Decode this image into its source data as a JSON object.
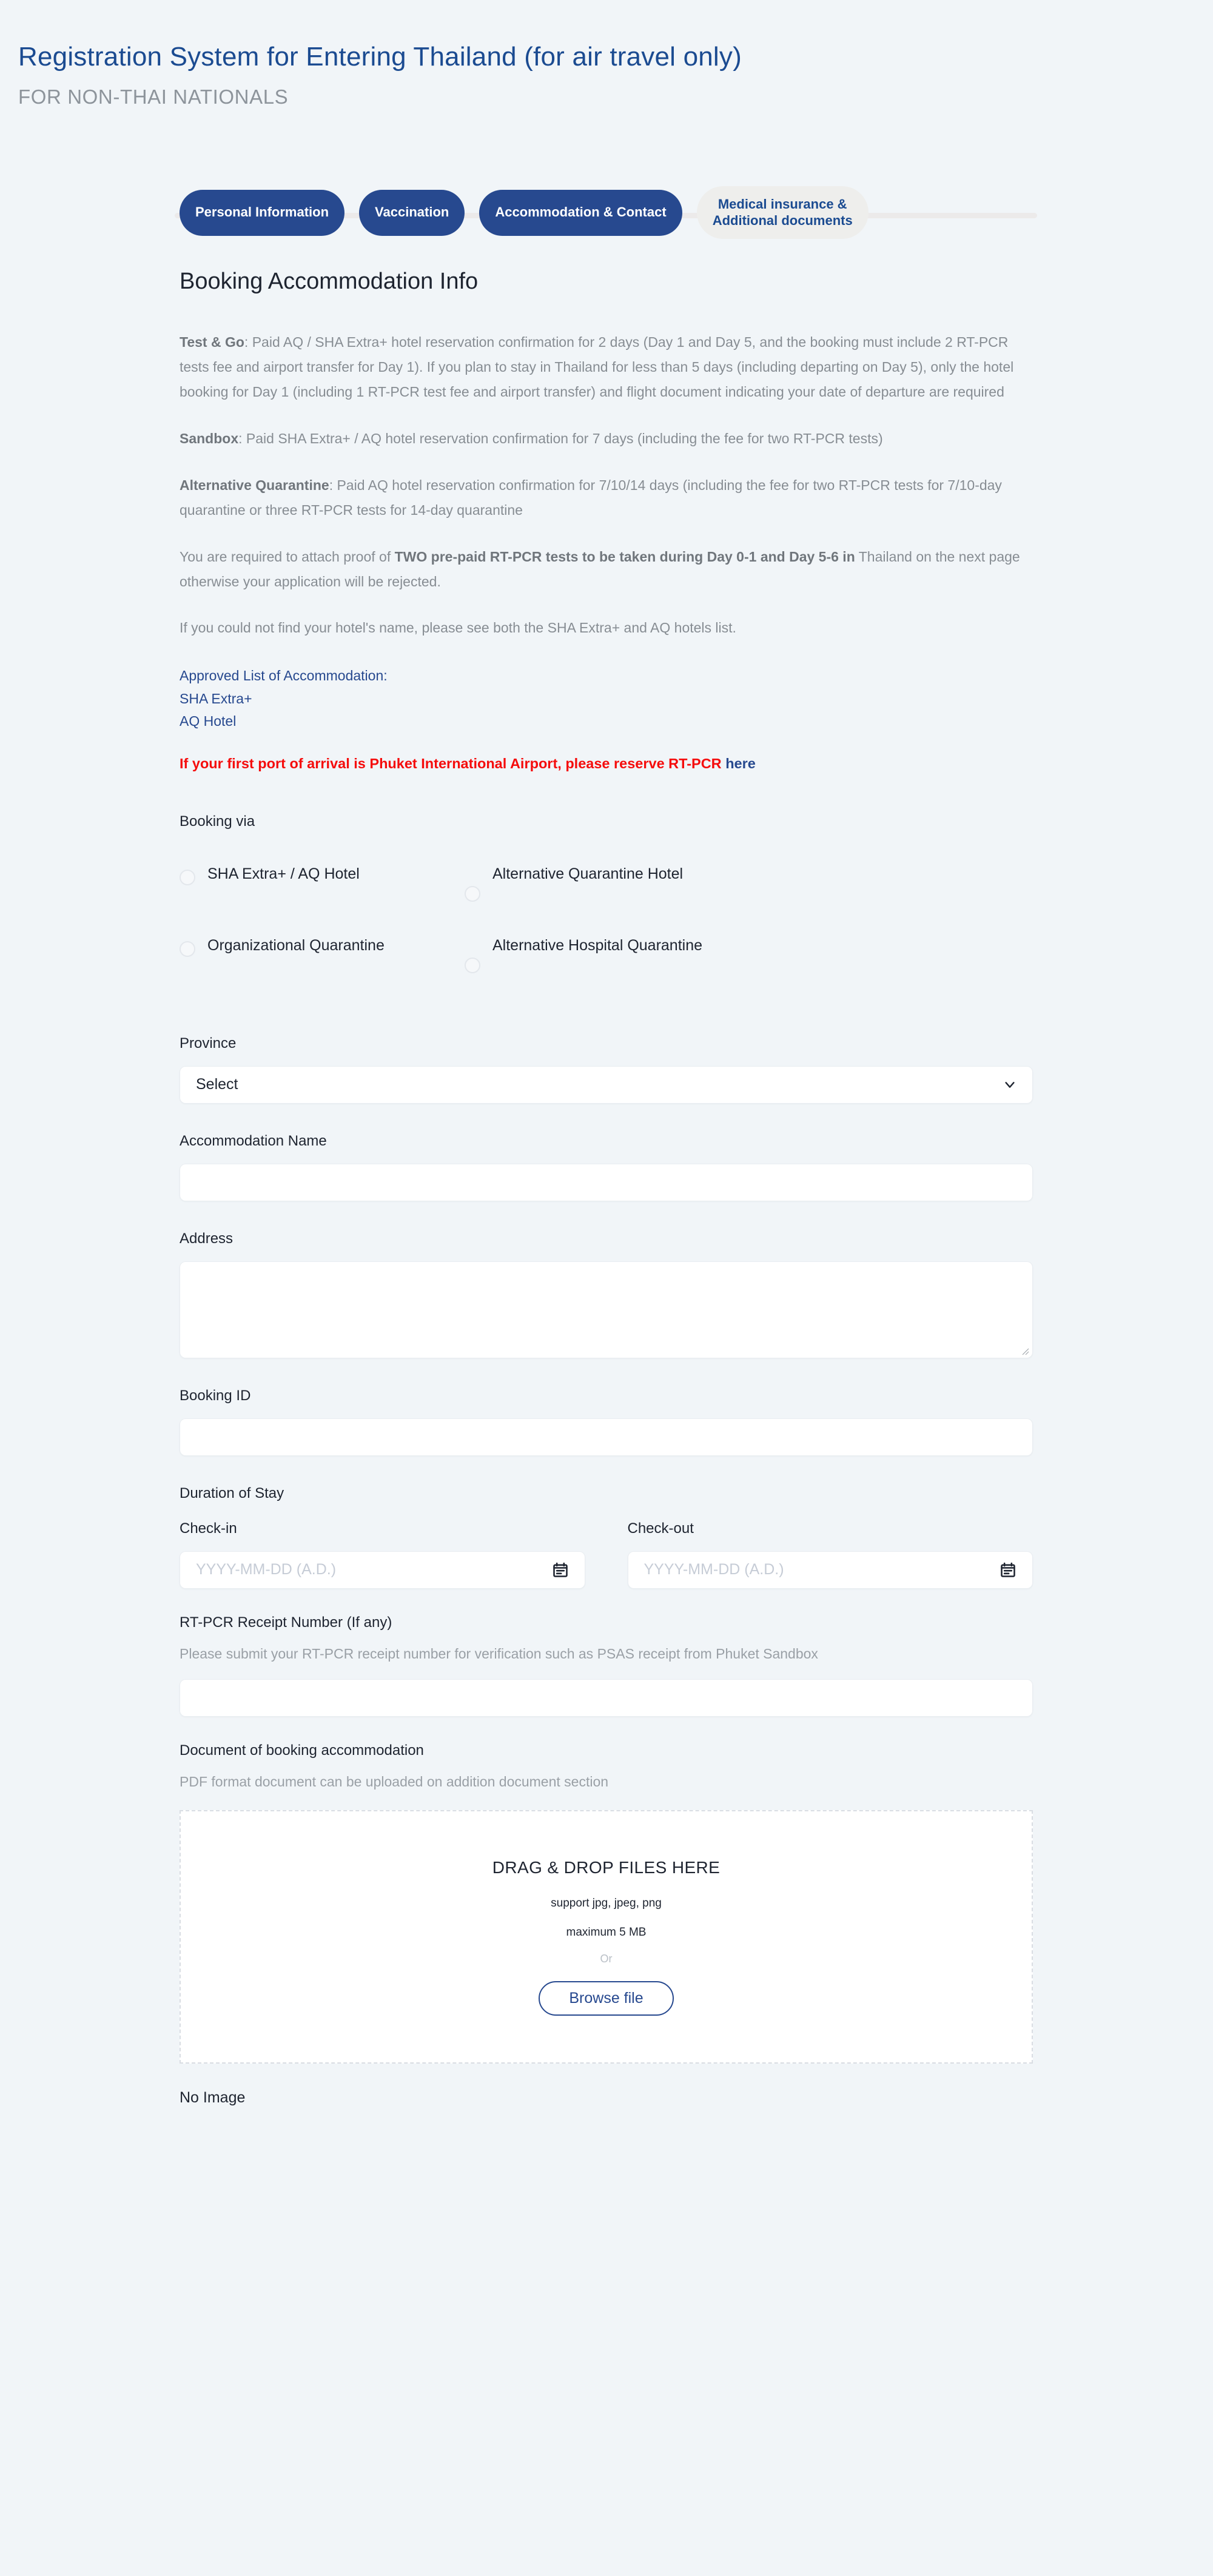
{
  "header": {
    "title": "Registration System for Entering Thailand (for air travel only)",
    "subtitle": "FOR NON-THAI NATIONALS"
  },
  "colors": {
    "page_background": "#f1f5f8",
    "brand_blue": "#27498f",
    "title_blue": "#1b4b91",
    "alert_red": "#f50c0c",
    "inactive_tab": "#eeeeec",
    "body_gray": "#878d93"
  },
  "stepper": {
    "tabs": [
      {
        "label": "Personal Information",
        "state": "active"
      },
      {
        "label": "Vaccination",
        "state": "active"
      },
      {
        "label": "Accommodation & Contact",
        "state": "active"
      },
      {
        "label": "Medical insurance &\nAdditional documents",
        "state": "inactive"
      }
    ]
  },
  "main": {
    "section_title": "Booking Accommodation Info",
    "paragraphs": [
      {
        "lead": "Test & Go",
        "text": ": Paid AQ / SHA Extra+ hotel reservation confirmation for 2 days (Day 1 and Day 5, and the booking must include 2 RT-PCR tests fee and airport transfer for Day 1). If you plan to stay in Thailand for less than 5 days (including departing on Day 5), only the hotel booking for Day 1 (including 1 RT-PCR test fee and airport transfer) and flight document indicating your date of departure are required"
      },
      {
        "lead": "Sandbox",
        "text": ": Paid SHA Extra+ / AQ hotel reservation confirmation for 7 days (including the fee for two RT-PCR tests)"
      },
      {
        "lead": "Alternative Quarantine",
        "text": ": Paid AQ hotel reservation confirmation for 7/10/14 days (including the fee for two RT-PCR tests for 7/10-day quarantine or three RT-PCR tests for 14-day quarantine"
      }
    ],
    "notice_prefix": "You are required to attach proof of ",
    "notice_bold": "TWO pre-paid RT-PCR tests to be taken during Day 0-1 and Day 5-6 in",
    "notice_suffix": " Thailand on the next page otherwise your application will be rejected.",
    "hotel_note": "If you could not find your hotel's name, please see both the SHA Extra+ and AQ hotels list.",
    "approved_list_heading": "Approved List of Accommodation:",
    "approved_links": [
      "SHA Extra+",
      "AQ Hotel"
    ],
    "alert_text": "If your first port of arrival is Phuket International Airport, please reserve RT-PCR ",
    "alert_link": "here"
  },
  "form": {
    "booking_via_label": "Booking via",
    "booking_via_options": [
      "SHA Extra+ / AQ Hotel",
      "Alternative Quarantine Hotel",
      "Organizational Quarantine",
      "Alternative Hospital Quarantine"
    ],
    "province": {
      "label": "Province",
      "selected": "Select"
    },
    "accommodation_name": {
      "label": "Accommodation Name",
      "value": ""
    },
    "address": {
      "label": "Address",
      "value": ""
    },
    "booking_id": {
      "label": "Booking ID",
      "value": ""
    },
    "duration": {
      "label": "Duration of Stay",
      "check_in": {
        "label": "Check-in",
        "value": "",
        "placeholder": "YYYY-MM-DD (A.D.)"
      },
      "check_out": {
        "label": "Check-out",
        "value": "",
        "placeholder": "YYYY-MM-DD (A.D.)"
      }
    },
    "rtpcr_receipt": {
      "label": "RT-PCR Receipt Number (If any)",
      "hint": "Please submit your RT-PCR receipt number for verification such as PSAS receipt from Phuket Sandbox",
      "value": ""
    },
    "document_upload": {
      "label": "Document of booking accommodation",
      "hint": "PDF format document can be uploaded on addition document section",
      "drop_title": "DRAG & DROP FILES HERE",
      "supported": "support jpg, jpeg, png",
      "max_size": "maximum 5 MB",
      "or": "Or",
      "browse_label": "Browse file",
      "status": "No Image"
    }
  }
}
